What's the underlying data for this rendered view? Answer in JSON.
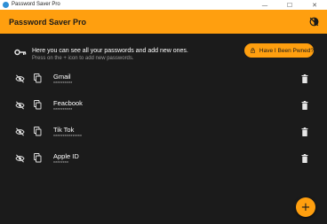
{
  "window": {
    "title": "Password Saver Pro",
    "minimize": "—",
    "maximize": "☐",
    "close": "✕"
  },
  "appbar": {
    "title": "Password Saver Pro",
    "theme_icon": "theme-toggle-icon"
  },
  "info": {
    "line1": "Here you can see all your passwords and add new ones.",
    "line2": "Press on the + icon to add new passwords.",
    "pwned_button": "Have I Been Pwned?"
  },
  "passwords": [
    {
      "name": "Gmail",
      "masked": "**********"
    },
    {
      "name": "Feacbook",
      "masked": "**********"
    },
    {
      "name": "Tik Tok",
      "masked": "***************"
    },
    {
      "name": "Apple ID",
      "masked": "********"
    }
  ],
  "fab": {
    "label": "+"
  },
  "colors": {
    "accent": "#ff9f0f",
    "background": "#1b1b1b"
  }
}
